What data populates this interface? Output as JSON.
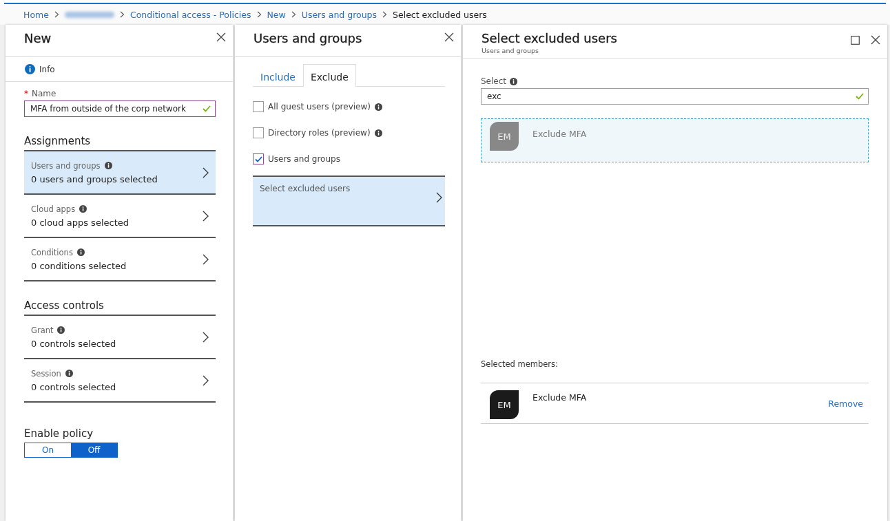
{
  "breadcrumb": [
    {
      "label": "Home",
      "kind": "link"
    },
    {
      "kind": "redacted"
    },
    {
      "label": "Conditional access - Policies",
      "kind": "link"
    },
    {
      "label": "New",
      "kind": "link"
    },
    {
      "label": "Users and groups",
      "kind": "link"
    },
    {
      "label": "Select excluded users",
      "kind": "current"
    }
  ],
  "new_blade": {
    "title": "New",
    "info": "Info",
    "name_field": {
      "label": "Name",
      "required_mark": "*",
      "value": "MFA from outside of the corp network",
      "valid": true
    },
    "sections": [
      {
        "heading": "Assignments",
        "items": [
          {
            "title": "Users and groups",
            "summary": "0 users and groups selected",
            "selected": true
          },
          {
            "title": "Cloud apps",
            "summary": "0 cloud apps selected",
            "selected": false
          },
          {
            "title": "Conditions",
            "summary": "0 conditions selected",
            "selected": false
          }
        ]
      },
      {
        "heading": "Access controls",
        "items": [
          {
            "title": "Grant",
            "summary": "0 controls selected",
            "selected": false
          },
          {
            "title": "Session",
            "summary": "0 controls selected",
            "selected": false
          }
        ]
      }
    ],
    "enable_policy": {
      "label": "Enable policy",
      "options": [
        {
          "label": "On",
          "selected": false
        },
        {
          "label": "Off",
          "selected": true
        }
      ]
    }
  },
  "users_blade": {
    "title": "Users and groups",
    "tabs": [
      {
        "label": "Include",
        "selected": false
      },
      {
        "label": "Exclude",
        "selected": true
      }
    ],
    "options": [
      {
        "label": "All guest users (preview)",
        "checked": false,
        "info": true
      },
      {
        "label": "Directory roles (preview)",
        "checked": false,
        "info": true
      },
      {
        "label": "Users and groups",
        "checked": true,
        "info": false
      }
    ],
    "picker": {
      "label": "Select excluded users",
      "selected": true
    }
  },
  "select_blade": {
    "title": "Select excluded users",
    "subtitle": "Users and groups",
    "search": {
      "label": "Select",
      "value": "exc",
      "valid": true
    },
    "results": [
      {
        "initials": "EM",
        "name": "Exclude MFA",
        "selected": true
      }
    ],
    "selected_heading": "Selected members:",
    "members": [
      {
        "initials": "EM",
        "name": "Exclude MFA",
        "action": "Remove"
      }
    ]
  }
}
